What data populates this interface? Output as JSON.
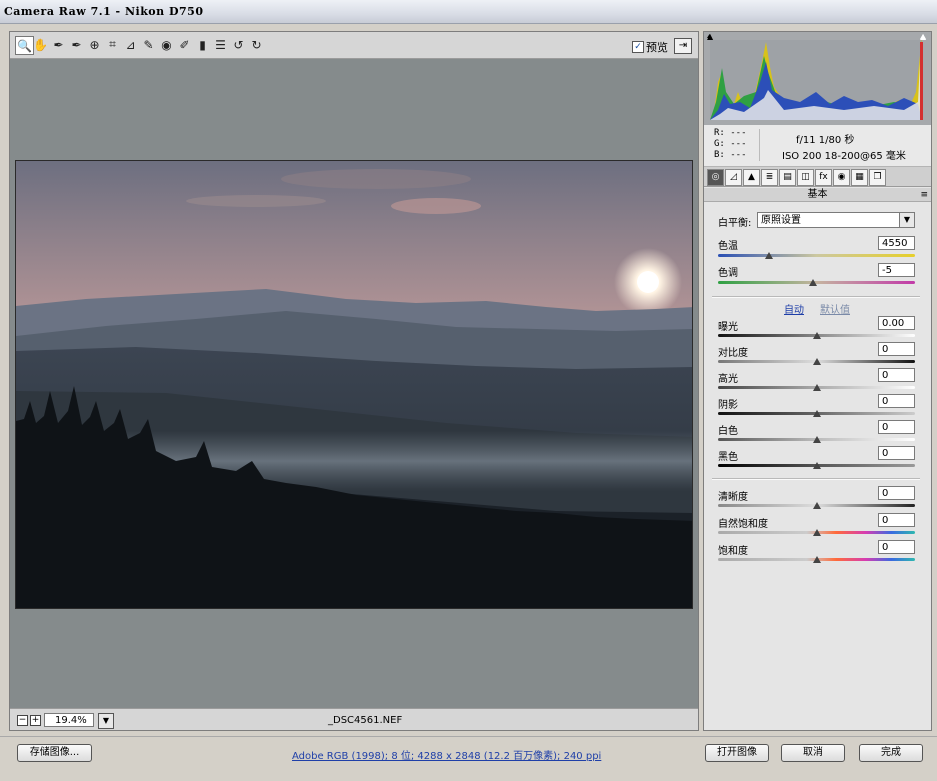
{
  "window": {
    "title": "Camera Raw 7.1 -  Nikon D750"
  },
  "toolbar": {
    "tools": [
      {
        "name": "zoom-tool-icon",
        "glyph": "🔍"
      },
      {
        "name": "hand-tool-icon",
        "glyph": "✋"
      },
      {
        "name": "white-balance-tool-icon",
        "glyph": "✒"
      },
      {
        "name": "color-sampler-tool-icon",
        "glyph": "✒"
      },
      {
        "name": "targeted-adjustment-tool-icon",
        "glyph": "⊕"
      },
      {
        "name": "crop-tool-icon",
        "glyph": "⌗"
      },
      {
        "name": "straighten-tool-icon",
        "glyph": "⊿"
      },
      {
        "name": "spot-removal-tool-icon",
        "glyph": "✎"
      },
      {
        "name": "red-eye-tool-icon",
        "glyph": "◉"
      },
      {
        "name": "adjustment-brush-icon",
        "glyph": "✐"
      },
      {
        "name": "graduated-filter-icon",
        "glyph": "▮"
      },
      {
        "name": "preferences-icon",
        "glyph": "☰"
      },
      {
        "name": "rotate-left-icon",
        "glyph": "↺"
      },
      {
        "name": "rotate-right-icon",
        "glyph": "↻"
      }
    ],
    "preview_label": "预览",
    "preview_checked": "✓"
  },
  "status": {
    "zoom": "19.4%",
    "filename": "_DSC4561.NEF"
  },
  "info": {
    "r": "R:  ---",
    "g": "G:  ---",
    "b": "B:  ---",
    "aperture_shutter": "f/11  1/80 秒",
    "iso_lens": "ISO 200  18-200@65 毫米"
  },
  "panel": {
    "title": "基本",
    "white_balance_label": "白平衡:",
    "white_balance_value": "原照设置",
    "auto_label": "自动",
    "default_label": "默认值",
    "sliders": [
      {
        "key": "temp",
        "label": "色温",
        "value": "4550",
        "fraction": 0.26
      },
      {
        "key": "tint",
        "label": "色调",
        "value": "-5",
        "fraction": 0.48
      },
      {
        "key": "exposure",
        "label": "曝光",
        "value": "0.00",
        "fraction": 0.5
      },
      {
        "key": "contrast",
        "label": "对比度",
        "value": "0",
        "fraction": 0.5
      },
      {
        "key": "highlights",
        "label": "高光",
        "value": "0",
        "fraction": 0.5
      },
      {
        "key": "shadows",
        "label": "阴影",
        "value": "0",
        "fraction": 0.5
      },
      {
        "key": "whites",
        "label": "白色",
        "value": "0",
        "fraction": 0.5
      },
      {
        "key": "blacks",
        "label": "黑色",
        "value": "0",
        "fraction": 0.5
      },
      {
        "key": "clarity",
        "label": "清晰度",
        "value": "0",
        "fraction": 0.5
      },
      {
        "key": "vibrance",
        "label": "自然饱和度",
        "value": "0",
        "fraction": 0.5
      },
      {
        "key": "saturation",
        "label": "饱和度",
        "value": "0",
        "fraction": 0.5
      }
    ]
  },
  "footer": {
    "save_label": "存储图像...",
    "workflow": "Adobe RGB (1998); 8 位; 4288 x 2848 (12.2 百万像素); 240 ppi",
    "open_label": "打开图像",
    "cancel_label": "取消",
    "done_label": "完成"
  }
}
